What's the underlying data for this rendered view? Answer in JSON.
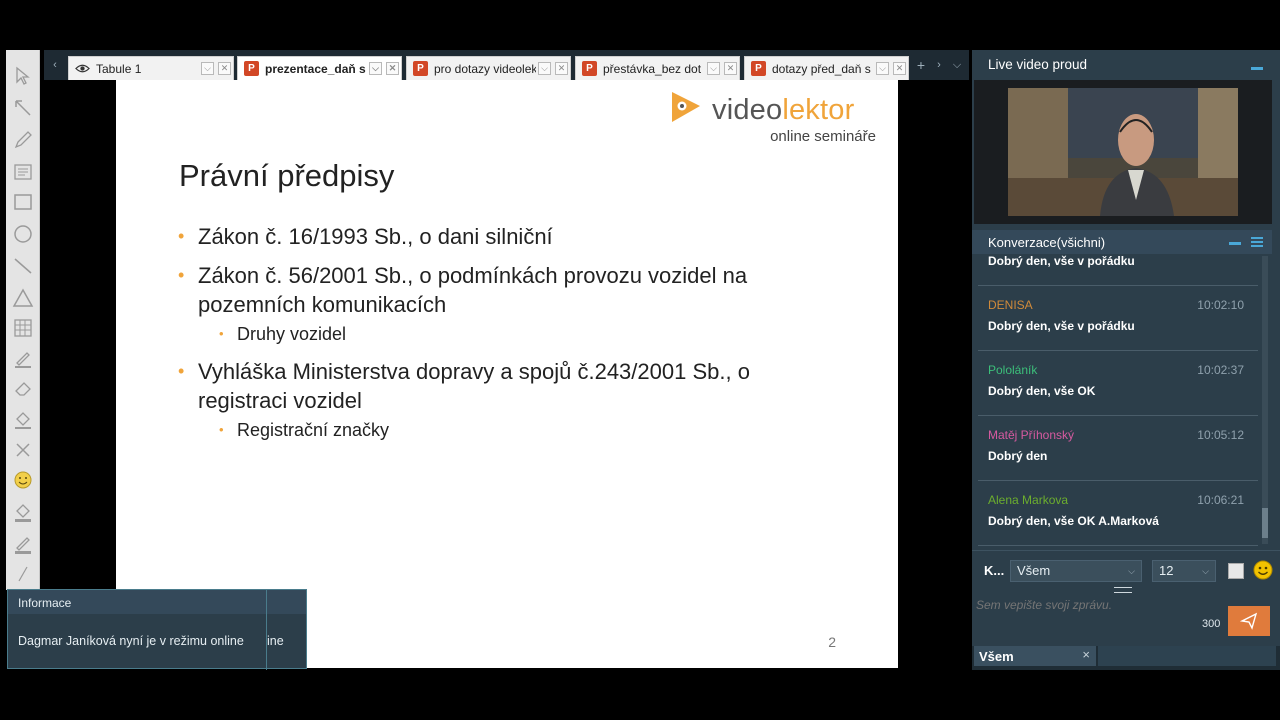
{
  "tabs": [
    {
      "label": "Tabule 1",
      "icon": "eye-icon",
      "active": false
    },
    {
      "label": "prezentace_daň s",
      "icon": "powerpoint-icon",
      "active": true
    },
    {
      "label": "pro dotazy videolek",
      "icon": "powerpoint-icon",
      "active": false
    },
    {
      "label": "přestávka_bez dot",
      "icon": "powerpoint-icon",
      "active": false
    },
    {
      "label": "dotazy před_daň s",
      "icon": "powerpoint-icon",
      "active": false
    }
  ],
  "tab_icon_letter": "P",
  "tab_controls": {
    "dropdown": "⌵",
    "close": "✕"
  },
  "tab_nav": {
    "prev": "‹",
    "next": "›",
    "add": "+",
    "more": "⌵"
  },
  "slide": {
    "logo": {
      "main_plain": "video",
      "main_accent": "lektor",
      "subtitle": "online semináře"
    },
    "title": "Právní předpisy",
    "bullets": [
      {
        "lines": [
          "Zákon č. 16/1993 Sb., o dani silniční"
        ]
      },
      {
        "lines": [
          "Zákon č. 56/2001 Sb., o podmínkách provozu vozidel na",
          "pozemních komunikacích"
        ]
      },
      {
        "lines": [
          "Vyhláška Ministerstva dopravy a spojů č.243/2001 Sb., o",
          "registraci vozidel"
        ]
      }
    ],
    "sub_bullets": [
      "Druhy vozidel",
      "Registrační značky"
    ],
    "bullet_char": "•",
    "page_number": "2",
    "accent_color": "#f0a43a"
  },
  "info_popup": {
    "title": "Informace",
    "message": "Dagmar Janíková nyní je v režimu online",
    "message_overflow": "ine"
  },
  "video_panel": {
    "title": "Live video proud"
  },
  "chat": {
    "title": "Konverzace(všichni)",
    "messages": [
      {
        "author": "",
        "time": "",
        "text": "Dobrý den, vše v pořádku",
        "color": "#ffffff"
      },
      {
        "author": "DENISA",
        "time": "10:02:10",
        "text": "Dobrý den, vše v pořádku",
        "color": "#d08a3a"
      },
      {
        "author": "Pololáník",
        "time": "10:02:37",
        "text": "Dobrý den, vše OK",
        "color": "#3cbf7a"
      },
      {
        "author": "Matěj Příhonský",
        "time": "10:05:12",
        "text": "Dobrý den",
        "color": "#d65aa0"
      },
      {
        "author": "Alena Markova",
        "time": "10:06:21",
        "text": "Dobrý den, vše OK A.Marková",
        "color": "#6cae2e"
      }
    ],
    "to_label": "K...",
    "recipient": "Všem",
    "font_size": "12",
    "placeholder": "Sem vepište svoji zprávu.",
    "char_count": "300",
    "caret": "⌵"
  },
  "bottom_tab": {
    "label": "Všem",
    "close": "×"
  }
}
